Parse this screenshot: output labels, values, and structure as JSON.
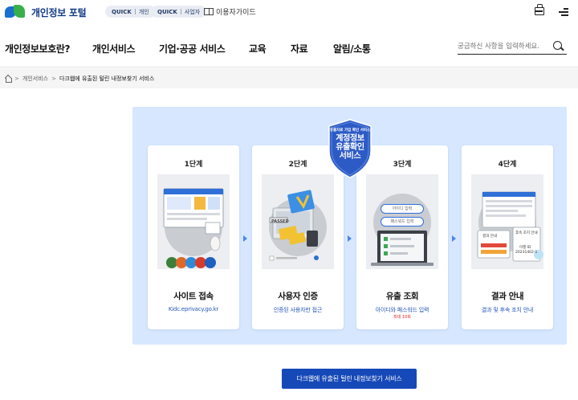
{
  "header": {
    "logo_text": "개인정보 포털",
    "quick_personal": {
      "prefix": "QUICK",
      "label": "개인"
    },
    "quick_business": {
      "prefix": "QUICK",
      "label": "사업자"
    },
    "user_guide": "이용자가이드"
  },
  "nav": {
    "items": [
      "개인정보보호란?",
      "개인서비스",
      "기업·공공 서비스",
      "교육",
      "자료",
      "알림/소통"
    ],
    "active_index": 1
  },
  "search": {
    "placeholder": "궁금하신 사항을 입력하세요."
  },
  "breadcrumb": {
    "items": [
      "개인서비스",
      "다크웹에 유출된 털린 내정보찾기 서비스"
    ]
  },
  "badge": {
    "small": "유출자료 가입 확인 서비스",
    "title": "계정정보\n유출확인\n서비스"
  },
  "steps": [
    {
      "step": "1단계",
      "title": "사이트 접속",
      "desc": "Kidc.eprivacy.go.kr",
      "note": ""
    },
    {
      "step": "2단계",
      "title": "사용자 인증",
      "desc": "인증된 사용자만 접근",
      "note": ""
    },
    {
      "step": "3단계",
      "title": "유출 조회",
      "desc": "아이디와 패스워드 입력",
      "note": "최대 10회"
    },
    {
      "step": "4단계",
      "title": "결과 안내",
      "desc": "결과 및 후속 조치 안내",
      "note": ""
    }
  ],
  "illustrations": {
    "step2_label": "PASSED",
    "step3_id": "아이디 입력",
    "step3_pw": "패스워드 입력",
    "step4_items": [
      "결과 안내",
      "후속 조치 안내",
      "이행 ID",
      "20231402-1"
    ]
  },
  "cta": {
    "label": "다크웹에 유출된 털린 내정보찾기 서비스"
  },
  "colors": {
    "primary": "#1649b8",
    "panel": "#d7e7ff",
    "highlight": "#c9f24a",
    "accent": "#2456b8"
  }
}
